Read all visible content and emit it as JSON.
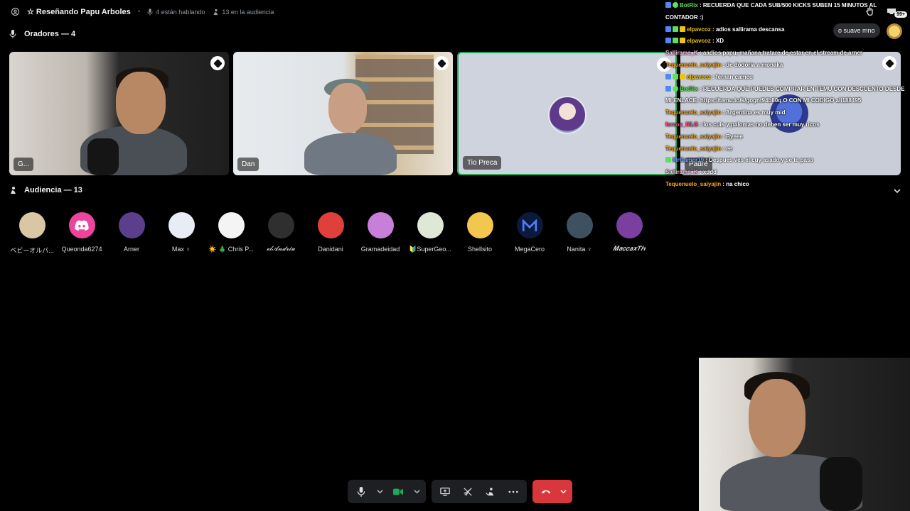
{
  "topbar": {
    "stage_title": "☆ Reseñando Papu Arboles",
    "speaking": "4 están hablando",
    "audience": "13 en la audiencia"
  },
  "speakers_section": {
    "label": "Oradores — 4"
  },
  "speakers": [
    {
      "name": "G..."
    },
    {
      "name": "Dan"
    },
    {
      "name": "Tio Preca"
    },
    {
      "name": "Padre"
    }
  ],
  "audience_section": {
    "label": "Audiencia — 13"
  },
  "audience": [
    {
      "name": "ベビーオルバ...",
      "color": "#d9c6a5"
    },
    {
      "name": "Queonda6274",
      "color": "#eb459e"
    },
    {
      "name": "Arner",
      "color": "#5b3f8c"
    },
    {
      "name": "Max ♀",
      "color": "#e8edf5"
    },
    {
      "name": "☀️ 🎄 Chris P...",
      "color": "#f4f4f4"
    },
    {
      "name": "𝓮𝓵𝓐𝓷𝓭𝓻𝓲𝓾",
      "color": "#2f2f2f"
    },
    {
      "name": "Danidani",
      "color": "#e0403b"
    },
    {
      "name": "Gramadeidad",
      "color": "#c87fd9"
    },
    {
      "name": "🔰SuperGeo...",
      "color": "#dfe7d7"
    },
    {
      "name": "Shellsito",
      "color": "#f3c64d"
    },
    {
      "name": "MegaCero",
      "color": "#0b1a3b"
    },
    {
      "name": "Nanita ♀",
      "color": "#3d5160"
    },
    {
      "name": "𝑴𝒂𝒄𝒄𝒂𝒙𝑻𝑯",
      "color": "#7b3fa0"
    }
  ],
  "chat": [
    {
      "user": "BotRix",
      "user_color": "#5de05d",
      "text": "RECUERDA QUE CADA SUB/500 KICKS SUBEN 15 MINUTOS AL CONTADOR :)"
    },
    {
      "user": "elpavcoz",
      "user_color": "#f1c40f",
      "text": "adios sallirama descansa"
    },
    {
      "user": "elpavcoz",
      "user_color": "#f1c40f",
      "text": "XD"
    },
    {
      "user": "Sallirama_K",
      "user_color": "#ffc0e6",
      "text": "aadios papu, mañana tratare de estar en el stream de arner"
    },
    {
      "user": "Tequenuelo_saiyajin",
      "user_color": "#f5a623",
      "text": "de dodoria a monaka"
    },
    {
      "user": "elpavcoz",
      "user_color": "#f1c40f",
      "text": "fernan cameo"
    },
    {
      "user": "BotRix",
      "user_color": "#5de05d",
      "text": "RECUERDA QUE PUEDES COMPRAR EN TEMU CON DESCUENTO DESDE MI ENLACE: https://temu.to/k/gognt94b80q O CON MI CODIGO ali188495"
    },
    {
      "user": "Tequenuelo_saiyajin",
      "user_color": "#f5a623",
      "text": "Argentina es muy mid"
    },
    {
      "user": "fercox_MLG",
      "user_color": "#ff4f7a",
      "text": "los cuis y palomas no deben ser muy ricos"
    },
    {
      "user": "Tequenuelo_saiyajin",
      "user_color": "#f5a623",
      "text": "Byeee"
    },
    {
      "user": "Tequenuelo_saiyajin",
      "user_color": "#f5a623",
      "text": "ee"
    },
    {
      "user": "MrGamer19",
      "user_color": "#6fa8ff",
      "text": "Despues ves el cuy asado y se te pasa"
    },
    {
      "user": "Sallirama_K",
      "user_color": "#ffc0e6",
      "text": "xddd"
    },
    {
      "user": "Tequenuelo_saiyajin",
      "user_color": "#f5a623",
      "text": "na chico"
    }
  ],
  "header_right": {
    "inbox_count": "99+",
    "suave_label": "o suave mno"
  }
}
